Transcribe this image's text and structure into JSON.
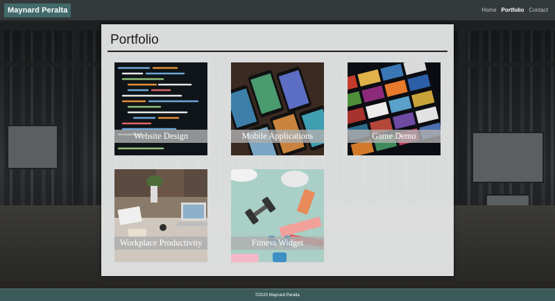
{
  "navbar": {
    "brand": "Maynard Peralta",
    "links": [
      {
        "label": "Home",
        "active": false
      },
      {
        "label": "Portfolio",
        "active": true
      },
      {
        "label": "Contact",
        "active": false
      }
    ]
  },
  "main": {
    "title": "Portfolio",
    "projects": [
      {
        "caption": "Website Design"
      },
      {
        "caption": "Mobile Applications"
      },
      {
        "caption": "Game Demo"
      },
      {
        "caption": "Workplace Productivity"
      },
      {
        "caption": "Fitness Widget"
      }
    ]
  },
  "footer": {
    "text": "©2020 Maynard Peralta"
  },
  "colors": {
    "navbar": "#34393b",
    "brand_bg": "#426a6a",
    "footer": "#3d5a5a"
  }
}
